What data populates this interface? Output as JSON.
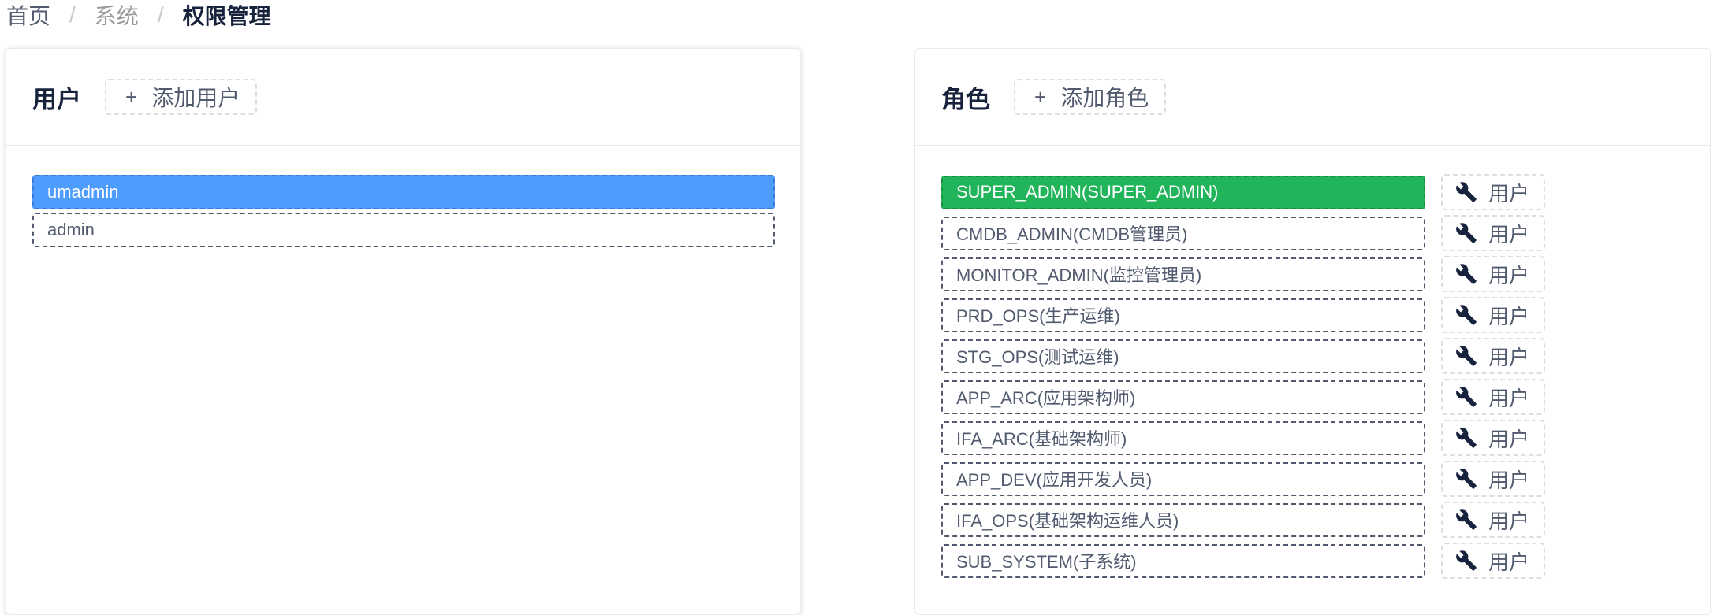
{
  "breadcrumb": {
    "home": "首页",
    "system": "系统",
    "current": "权限管理",
    "separator": "/"
  },
  "users_panel": {
    "title": "用户",
    "add_label": "添加用户",
    "items": [
      {
        "label": "umadmin",
        "selected": true
      },
      {
        "label": "admin",
        "selected": false
      }
    ]
  },
  "roles_panel": {
    "title": "角色",
    "add_label": "添加角色",
    "user_button_label": "用户",
    "user_button_icon": "wrench-icon",
    "items": [
      {
        "label": "SUPER_ADMIN(SUPER_ADMIN)",
        "selected": true
      },
      {
        "label": "CMDB_ADMIN(CMDB管理员)",
        "selected": false
      },
      {
        "label": "MONITOR_ADMIN(监控管理员)",
        "selected": false
      },
      {
        "label": "PRD_OPS(生产运维)",
        "selected": false
      },
      {
        "label": "STG_OPS(测试运维)",
        "selected": false
      },
      {
        "label": "APP_ARC(应用架构师)",
        "selected": false
      },
      {
        "label": "IFA_ARC(基础架构师)",
        "selected": false
      },
      {
        "label": "APP_DEV(应用开发人员)",
        "selected": false
      },
      {
        "label": "IFA_OPS(基础架构运维人员)",
        "selected": false
      },
      {
        "label": "SUB_SYSTEM(子系统)",
        "selected": false
      }
    ]
  },
  "colors": {
    "selected_user": "#4f9cff",
    "selected_role": "#22b45a",
    "text": "#515a6e"
  }
}
